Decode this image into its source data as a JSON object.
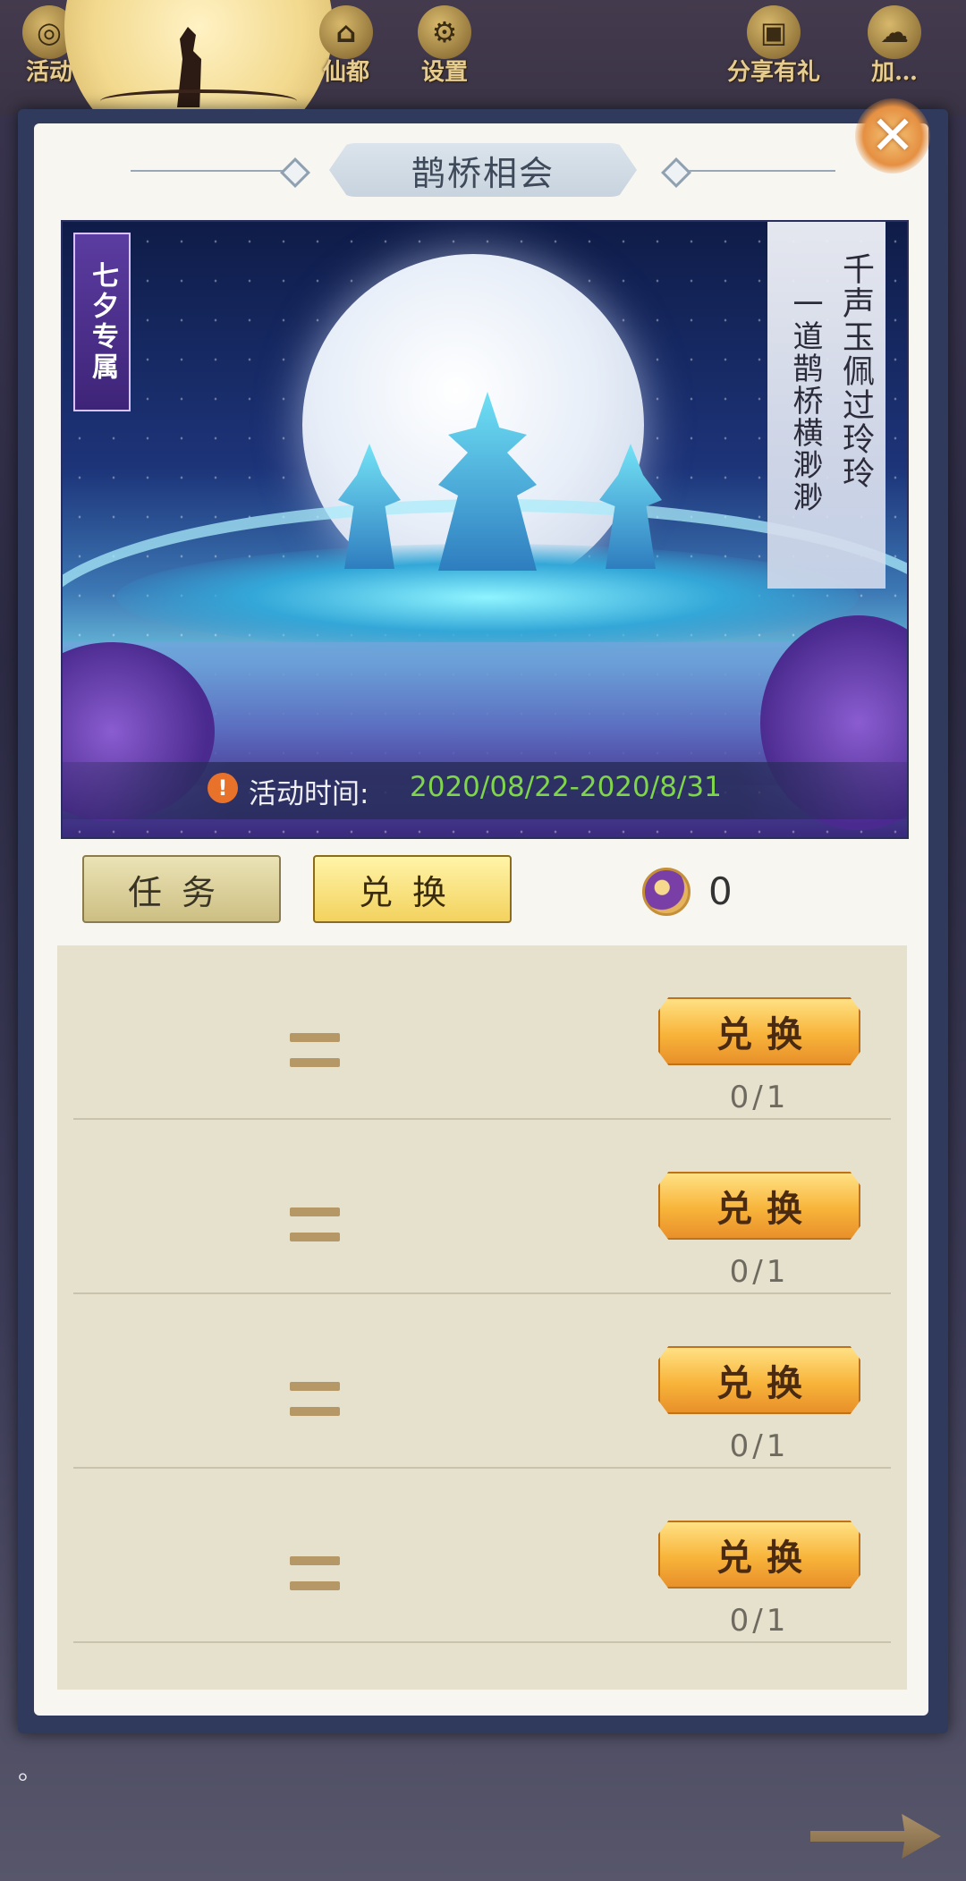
{
  "nav": {
    "items": [
      {
        "label": "活动",
        "icon": "coin-icon"
      },
      {
        "label": "仙都",
        "icon": "palace-icon"
      },
      {
        "label": "设置",
        "icon": "gear-icon"
      },
      {
        "label": "分享有礼",
        "icon": "gift-icon"
      },
      {
        "label": "加… ",
        "icon": "cloud-icon"
      }
    ]
  },
  "dialog": {
    "title": "鹊桥相会",
    "close_icon": "close-icon",
    "banner": {
      "badge": "七夕专属",
      "poem_line1": "千声玉佩过玲玲",
      "poem_line2": "一道鹊桥横渺渺",
      "time_label": "活动时间:",
      "time_value": "2020/08/22-2020/8/31"
    },
    "tabs": {
      "task": "任务",
      "exchange": "兑换",
      "active": "exchange"
    },
    "currency": {
      "icon": "magpie-coin-icon",
      "value": "0"
    },
    "exchange_rows": [
      {
        "button": "兑换",
        "progress": "0/1"
      },
      {
        "button": "兑换",
        "progress": "0/1"
      },
      {
        "button": "兑换",
        "progress": "0/1"
      },
      {
        "button": "兑换",
        "progress": "0/1"
      }
    ]
  },
  "footer": {
    "stray_text": "。",
    "next_icon": "arrow-right-icon"
  },
  "colors": {
    "accent_gold": "#f8b43a",
    "time_green": "#7fd64a",
    "panel_bg": "#e6e1cd"
  }
}
